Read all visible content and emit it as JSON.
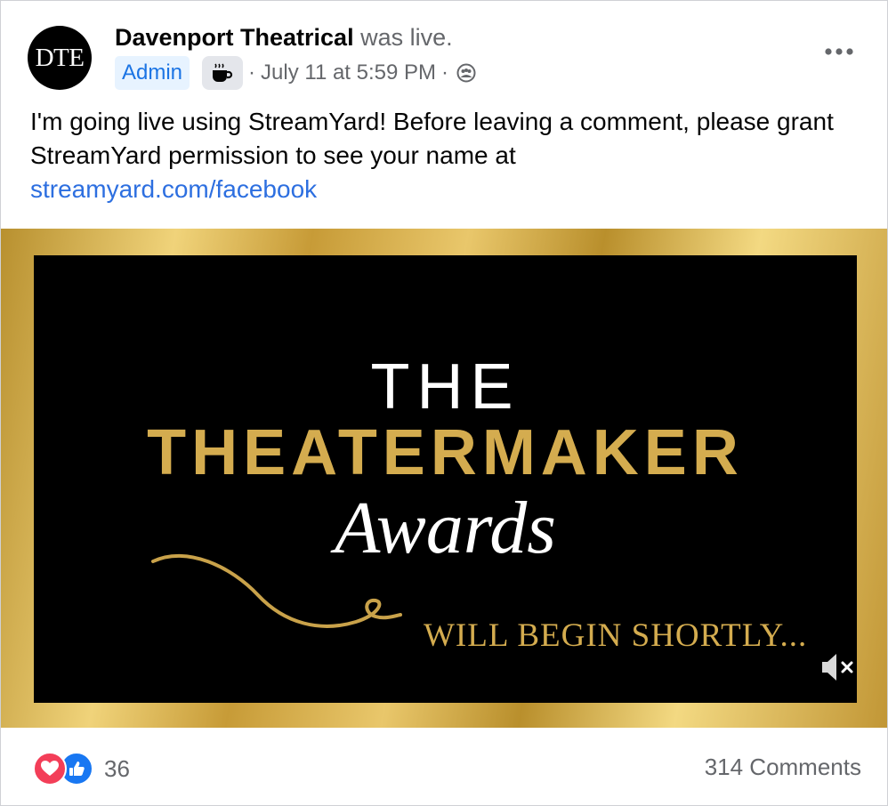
{
  "post": {
    "avatar_text": "DTE",
    "page_name": "Davenport Theatrical",
    "status_text": "was live.",
    "admin_badge": "Admin",
    "separator": "·",
    "timestamp": "July 11 at 5:59 PM",
    "more_icon": "more-horizontal-icon",
    "audience_icon": "friends-audience-icon",
    "body_text": "I'm going live using StreamYard! Before leaving a comment, please grant StreamYard permission to see your name at",
    "link_text": "streamyard.com/facebook"
  },
  "media": {
    "line1": "THE",
    "line2": "THEATERMAKER",
    "line3": "Awards",
    "line4": "WILL BEGIN SHORTLY...",
    "mute_icon": "volume-muted-icon"
  },
  "footer": {
    "reaction_count": "36",
    "comments": "314 Comments"
  },
  "colors": {
    "accent_blue": "#1b74e4",
    "link_blue": "#2d6fe0",
    "gold": "#d4ac4f",
    "secondary_text": "#65676b",
    "love_red": "#f33e58",
    "like_blue": "#1877f2"
  }
}
